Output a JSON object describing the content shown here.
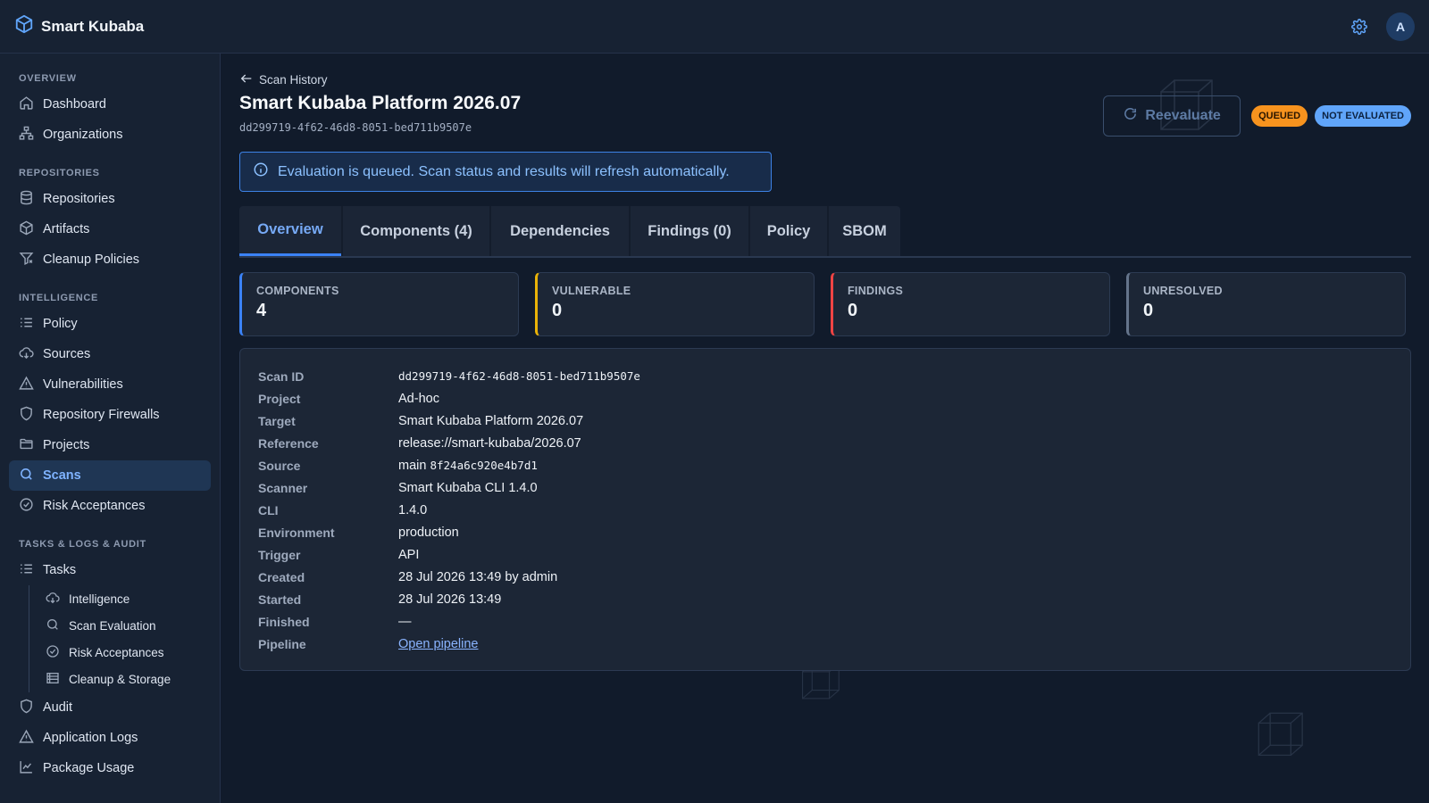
{
  "app": {
    "title": "Smart Kubaba",
    "avatar_initial": "A"
  },
  "colors": {
    "accent": "#3b82f6",
    "queued": "#f7931e",
    "not_evaluated": "#60a5fa",
    "warning_border": "#eab308",
    "danger_border": "#ef4444"
  },
  "sidebar": {
    "sections": [
      {
        "title": "OVERVIEW",
        "items": [
          {
            "label": "Dashboard",
            "icon": "home-icon"
          },
          {
            "label": "Organizations",
            "icon": "org-icon"
          }
        ]
      },
      {
        "title": "REPOSITORIES",
        "items": [
          {
            "label": "Repositories",
            "icon": "database-icon"
          },
          {
            "label": "Artifacts",
            "icon": "box-icon"
          },
          {
            "label": "Cleanup Policies",
            "icon": "filter-icon"
          }
        ]
      },
      {
        "title": "INTELLIGENCE",
        "items": [
          {
            "label": "Policy",
            "icon": "list-icon"
          },
          {
            "label": "Sources",
            "icon": "cloud-icon"
          },
          {
            "label": "Vulnerabilities",
            "icon": "warning-icon"
          },
          {
            "label": "Repository Firewalls",
            "icon": "shield-icon"
          },
          {
            "label": "Projects",
            "icon": "folder-icon"
          },
          {
            "label": "Scans",
            "icon": "search-icon",
            "active": true
          },
          {
            "label": "Risk Acceptances",
            "icon": "check-circle-icon"
          }
        ]
      },
      {
        "title": "TASKS & LOGS & AUDIT",
        "items": [
          {
            "label": "Tasks",
            "icon": "list-icon"
          },
          {
            "label": "Intelligence",
            "icon": "cloud-icon",
            "sub": true
          },
          {
            "label": "Scan Evaluation",
            "icon": "search-icon",
            "sub": true
          },
          {
            "label": "Risk Acceptances",
            "icon": "check-circle-icon",
            "sub": true
          },
          {
            "label": "Cleanup & Storage",
            "icon": "storage-icon",
            "sub": true
          },
          {
            "label": "Audit",
            "icon": "shield-icon"
          },
          {
            "label": "Application Logs",
            "icon": "warning-icon"
          },
          {
            "label": "Package Usage",
            "icon": "chart-icon"
          }
        ]
      }
    ]
  },
  "header": {
    "back_label": "Scan History",
    "title": "Smart Kubaba Platform 2026.07",
    "scan_id": "dd299719-4f62-46d8-8051-bed711b9507e",
    "reevaluate_label": "Reevaluate",
    "badge_status": "QUEUED",
    "badge_evaluation": "NOT EVALUATED"
  },
  "alert": {
    "text": "Evaluation is queued. Scan status and results will refresh automatically."
  },
  "tabs": [
    {
      "label": "Overview",
      "active": true
    },
    {
      "label": "Components (4)"
    },
    {
      "label": "Dependencies"
    },
    {
      "label": "Findings (0)"
    },
    {
      "label": "Policy"
    },
    {
      "label": "SBOM"
    }
  ],
  "stats": [
    {
      "label": "COMPONENTS",
      "value": "4"
    },
    {
      "label": "VULNERABLE",
      "value": "0"
    },
    {
      "label": "FINDINGS",
      "value": "0"
    },
    {
      "label": "UNRESOLVED",
      "value": "0"
    }
  ],
  "details": {
    "scan_id_key": "Scan ID",
    "scan_id_val": "dd299719-4f62-46d8-8051-bed711b9507e",
    "project_key": "Project",
    "project_val": "Ad-hoc",
    "target_key": "Target",
    "target_val": "Smart Kubaba Platform 2026.07",
    "reference_key": "Reference",
    "reference_val": "release://smart-kubaba/2026.07",
    "source_key": "Source",
    "source_branch": "main",
    "source_commit": "8f24a6c920e4b7d1",
    "scanner_key": "Scanner",
    "scanner_val": "Smart Kubaba CLI 1.4.0",
    "cli_key": "CLI",
    "cli_val": "1.4.0",
    "environment_key": "Environment",
    "environment_val": "production",
    "trigger_key": "Trigger",
    "trigger_val": "API",
    "created_key": "Created",
    "created_val": "28 Jul 2026 13:49 by admin",
    "started_key": "Started",
    "started_val": "28 Jul 2026 13:49",
    "finished_key": "Finished",
    "finished_val": "—",
    "pipeline_key": "Pipeline",
    "pipeline_val": "Open pipeline"
  }
}
